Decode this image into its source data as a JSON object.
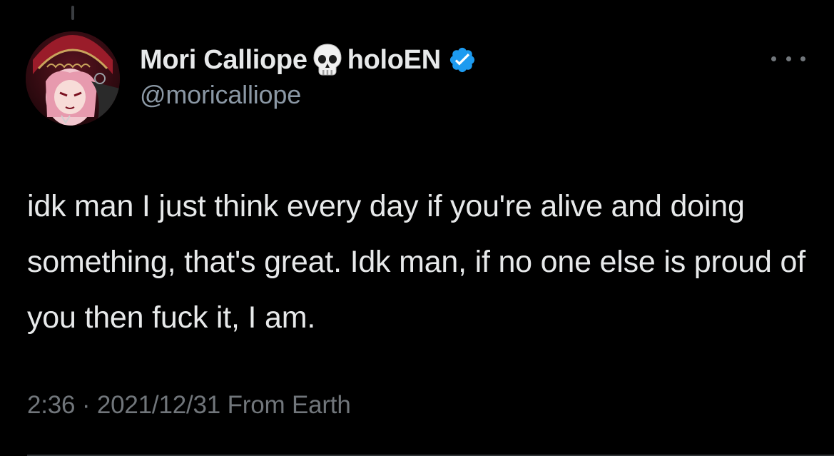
{
  "tweet": {
    "author": {
      "display_name": "Mori Calliope",
      "name_emoji": "skull-icon",
      "name_suffix": "holoEN",
      "verified_icon": "verified-badge-icon",
      "handle": "@moricalliope",
      "avatar_icon": "avatar-image"
    },
    "more_icon": "more-options-icon",
    "text": "idk man I just think every day if you're alive and doing something, that's great. Idk man, if no one else is proud of you then fuck it, I am.",
    "meta": {
      "time": "2:36",
      "separator": "·",
      "date": "2021/12/31",
      "source": "From Earth"
    }
  },
  "colors": {
    "background": "#000000",
    "primary_text": "#e7e9ea",
    "secondary_text": "#71767b",
    "verified_blue": "#1d9bf0"
  }
}
